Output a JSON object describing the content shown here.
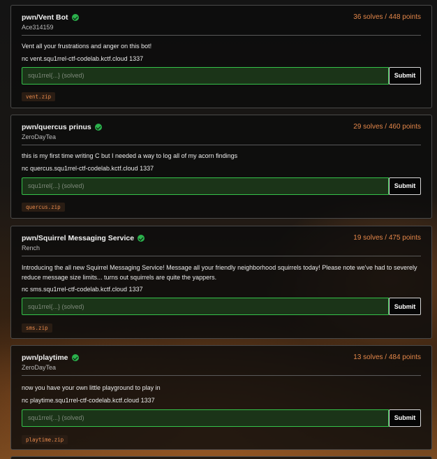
{
  "challenges": [
    {
      "title": "pwn/Vent Bot",
      "author": "Ace314159",
      "score": "36 solves / 448 points",
      "description": "Vent all your frustrations and anger on this bot!",
      "nc": "nc vent.squ1rrel-ctf-codelab.kctf.cloud 1337",
      "placeholder": "squ1rrel{...} (solved)",
      "submit_label": "Submit",
      "file": "vent.zip"
    },
    {
      "title": "pwn/quercus prinus",
      "author": "ZeroDayTea",
      "score": "29 solves / 460 points",
      "description": "this is my first time writing C but I needed a way to log all of my acorn findings",
      "nc": "nc quercus.squ1rrel-ctf-codelab.kctf.cloud 1337",
      "placeholder": "squ1rrel{...} (solved)",
      "submit_label": "Submit",
      "file": "quercus.zip"
    },
    {
      "title": "pwn/Squirrel Messaging Service",
      "author": "Rench",
      "score": "19 solves / 475 points",
      "description": "Introducing the all new Squirrel Messaging Service! Message all your friendly neighborhood squirrels today! Please note we've had to severely reduce message size limits... turns out squirrels are quite the yappers.",
      "nc": "nc sms.squ1rrel-ctf-codelab.kctf.cloud 1337",
      "placeholder": "squ1rrel{...} (solved)",
      "submit_label": "Submit",
      "file": "sms.zip"
    },
    {
      "title": "pwn/playtime",
      "author": "ZeroDayTea",
      "score": "13 solves / 484 points",
      "description": "now you have your own little playground to play in",
      "nc": "nc playtime.squ1rrel-ctf-codelab.kctf.cloud 1337",
      "placeholder": "squ1rrel{...} (solved)",
      "submit_label": "Submit",
      "file": "playtime.zip"
    }
  ],
  "colors": {
    "score": "#e4874a",
    "solved_check": "#2bb24c",
    "flag_border": "#35c24a",
    "file_text": "#e88a4c"
  },
  "icons": {
    "solved": "check-circle-icon"
  }
}
